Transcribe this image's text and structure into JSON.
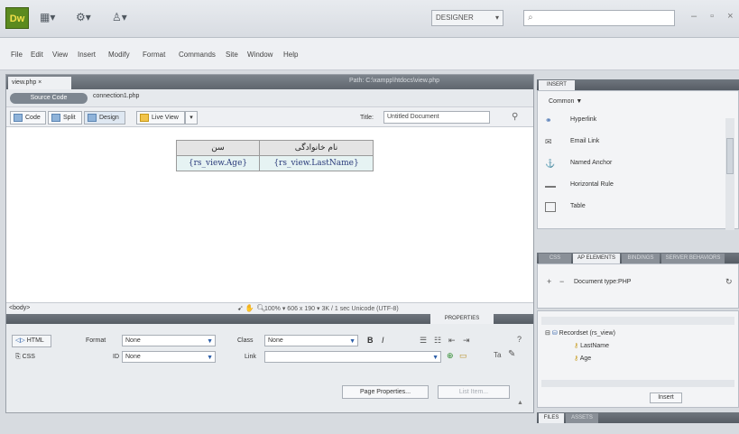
{
  "app": {
    "logo_text": "Dw",
    "workspace": "DESIGNER",
    "window_controls": "–  ▫  ×"
  },
  "toolbar_icons": [
    "layout-icon",
    "extend-icon",
    "site-icon"
  ],
  "menus": [
    "File",
    "Edit",
    "View",
    "Insert",
    "Modify",
    "Format",
    "Commands",
    "Site",
    "Window",
    "Help"
  ],
  "document": {
    "tab_label": "view.php ×",
    "path": "Path: C:\\xampp\\htdocs\\view.php",
    "source_code_label": "Source Code",
    "related_file": "connection1.php",
    "views": [
      "Code",
      "Split",
      "Design",
      "Live View"
    ],
    "title_label": "Title:",
    "title_value": "Untitled Document"
  },
  "table": {
    "headers": [
      "سن",
      "نام خانوادگی"
    ],
    "row": [
      "{rs_view.Age}",
      "{rs_view.LastName}"
    ]
  },
  "status": {
    "tag": "<body>",
    "info": "100% ▾  606 x 190 ▾  3K / 1 sec  Unicode (UTF-8)"
  },
  "properties": {
    "tab": "PROPERTIES",
    "html_label": "HTML",
    "css_label": "CSS",
    "format_label": "Format",
    "format_value": "None",
    "id_label": "ID",
    "id_value": "None",
    "class_label": "Class",
    "class_value": "None",
    "link_label": "Link",
    "link_value": "",
    "page_properties": "Page Properties...",
    "list_item": "List Item..."
  },
  "insert_panel": {
    "tab": "INSERT",
    "category": "Common ▼",
    "items": [
      "Hyperlink",
      "Email Link",
      "Named Anchor",
      "Horizontal Rule",
      "Table"
    ]
  },
  "css_panel": {
    "tabs": [
      "CSS STYLES",
      "AP ELEMENTS",
      "BINDINGS",
      "SERVER BEHAVIORS"
    ],
    "doc_type": "Document type:PHP"
  },
  "bindings": {
    "recordset": "Recordset (rs_view)",
    "fields": [
      "LastName",
      "Age"
    ],
    "insert_label": "Insert"
  },
  "files_panel": {
    "tabs": [
      "FILES",
      "ASSETS"
    ]
  },
  "colors": {
    "accent": "#5b8a1f",
    "panel_header": "#5f666e",
    "table_row": "#e6f3f3"
  }
}
